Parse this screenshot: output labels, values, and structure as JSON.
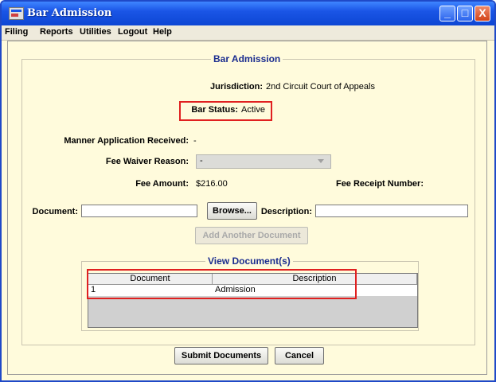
{
  "window": {
    "title": "Bar Admission",
    "minimize_label": "_",
    "maximize_label": "□",
    "close_label": "X"
  },
  "menu": {
    "items": [
      "Filing",
      "Reports",
      "Utilities",
      "Logout",
      "Help"
    ]
  },
  "form": {
    "group_title": "Bar Admission",
    "jurisdiction_label": "Jurisdiction:",
    "jurisdiction_value": "2nd Circuit Court of Appeals",
    "bar_status_label": "Bar Status:",
    "bar_status_value": "Active",
    "manner_label": "Manner Application Received:",
    "manner_value": "-",
    "fee_waiver_label": "Fee Waiver Reason:",
    "fee_waiver_value": "-",
    "fee_amount_label": "Fee Amount:",
    "fee_amount_value": "$216.00",
    "fee_receipt_label": "Fee Receipt Number:",
    "document_label": "Document:",
    "document_value": "",
    "browse_label": "Browse...",
    "description_label": "Description:",
    "description_value": "",
    "add_doc_label": "Add Another Document"
  },
  "documents": {
    "group_title": "View Document(s)",
    "columns": [
      "Document",
      "Description"
    ],
    "rows": [
      {
        "document": "1",
        "description": "Admission"
      }
    ]
  },
  "footer": {
    "submit_label": "Submit Documents",
    "cancel_label": "Cancel"
  },
  "colors": {
    "highlight_box": "#e02020",
    "title_bar": "#1a55e6",
    "panel_bg": "#fffbdc"
  }
}
